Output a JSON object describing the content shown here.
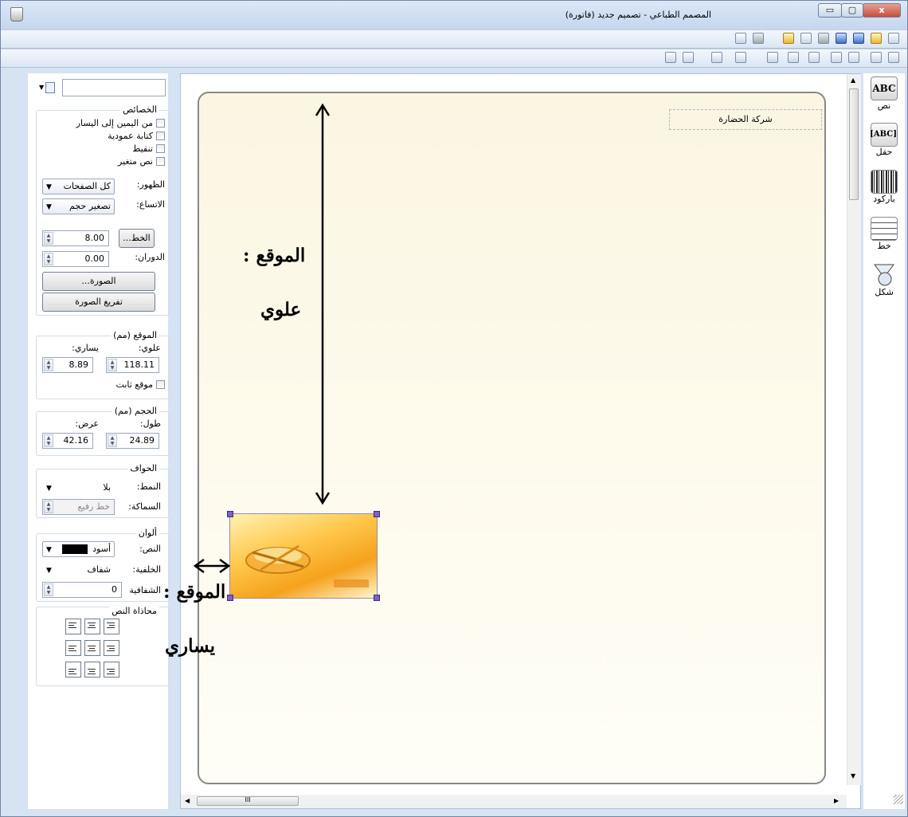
{
  "window": {
    "title": "المصمم الطباعي - تصميم جديد (فاتورة)",
    "close_label": "x"
  },
  "left_panel": {
    "properties": {
      "title": "الخصائص",
      "checkboxes": [
        "من اليمين إلى اليسار",
        "كتابة عمودية",
        "تنقيط",
        "نص متغير"
      ],
      "visibility_label": "الظهور:",
      "visibility_value": "كل الصفحات",
      "overflow_label": "الاتساع:",
      "overflow_value": "تصغير حجم",
      "font_button": "الخط...",
      "font_size": "8.00",
      "rotation_label": "الدوران:",
      "rotation_value": "0.00",
      "image_button": "الصورة...",
      "clear_image_button": "تفريغ الصورة"
    },
    "position": {
      "title": "الموقع (مم)",
      "top_label": "علوي:",
      "left_label": "يساري:",
      "top_value": "118.11",
      "left_value": "8.89",
      "fixed_label": "موقع ثابت"
    },
    "size": {
      "title": "الحجم (مم)",
      "height_label": "طول:",
      "width_label": "عرض:",
      "height_value": "24.89",
      "width_value": "42.16"
    },
    "borders": {
      "title": "الحواف",
      "style_label": "النمط:",
      "style_value": "بلا",
      "thickness_label": "السماكة:",
      "thickness_value": "خط رفيع"
    },
    "colors": {
      "title": "ألوان",
      "text_label": "النص:",
      "text_value": "أسود",
      "text_color": "#000000",
      "bg_label": "الخلفية:",
      "bg_value": "شفاف",
      "opacity_label": "الشفافية",
      "opacity_value": "0"
    },
    "alignment": {
      "title": "محاذاة النص"
    }
  },
  "canvas": {
    "company_text": "شركة الحضارة",
    "hscroll_grip": "III"
  },
  "tools": [
    {
      "label": "نص",
      "icon": "ABC"
    },
    {
      "label": "حقل",
      "icon": "[ABC]"
    },
    {
      "label": "باركود",
      "icon": ""
    },
    {
      "label": "خط",
      "icon": ""
    },
    {
      "label": "شكل",
      "icon": ""
    }
  ],
  "annotations": {
    "top_line1": "الموقع :",
    "top_line2": "علوي",
    "left_line1": "الموقع :",
    "left_line2": "يساري"
  }
}
